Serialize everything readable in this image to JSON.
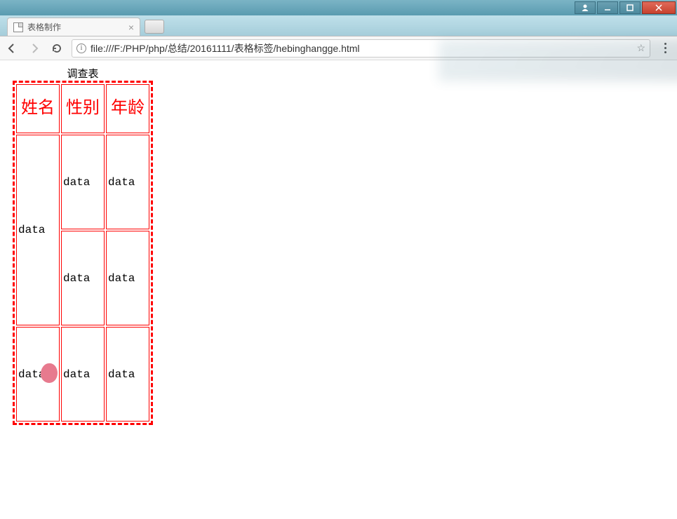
{
  "window": {
    "tab_title": "表格制作",
    "url": "file:///F:/PHP/php/总结/20161111/表格标签/hebinghangge.html"
  },
  "chart_data": {
    "type": "table",
    "caption": "调查表",
    "headers": [
      "姓名",
      "性别",
      "年龄"
    ],
    "rows": [
      {
        "cells": [
          "data",
          "data",
          "data"
        ],
        "rowspan_first": 2
      },
      {
        "cells": [
          "data",
          "data"
        ]
      },
      {
        "cells": [
          "data",
          "data",
          "data"
        ]
      }
    ],
    "display": {
      "row1": {
        "col1_text": "data",
        "col2": "data",
        "col3": "data"
      },
      "row2": {
        "col2": "data",
        "col3": "data"
      },
      "row3": {
        "col1": "data",
        "col2": "data",
        "col3": "data"
      }
    }
  }
}
